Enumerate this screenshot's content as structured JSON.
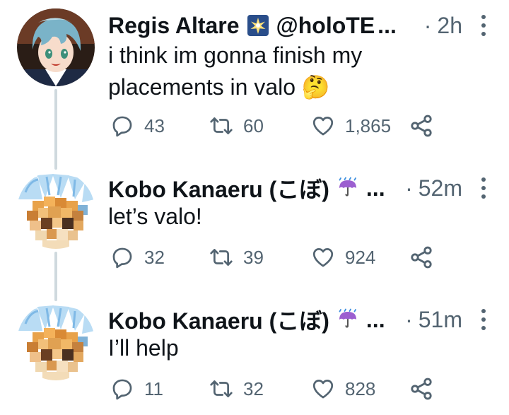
{
  "tweets": [
    {
      "author": {
        "name": "Regis Altare",
        "handle": "@holoTE",
        "truncation": "...",
        "badge_icon": "sparkle-badge-icon"
      },
      "dot": "·",
      "time": "2h",
      "text": "i think im gonna finish my\nplacements in valo",
      "emoji": "🤔",
      "stats": {
        "replies": "43",
        "retweets": "60",
        "likes": "1,865"
      }
    },
    {
      "author": {
        "name": "Kobo Kanaeru (こぼ)",
        "handle": "",
        "truncation": "...",
        "badge_icon": "umbrella-rain-icon"
      },
      "dot": "·",
      "time": "52m",
      "text": "let’s valo!",
      "stats": {
        "replies": "32",
        "retweets": "39",
        "likes": "924"
      }
    },
    {
      "author": {
        "name": "Kobo Kanaeru (こぼ)",
        "handle": "",
        "truncation": "...",
        "badge_icon": "umbrella-rain-icon"
      },
      "dot": "·",
      "time": "51m",
      "text": "I’ll help",
      "stats": {
        "replies": "11",
        "retweets": "32",
        "likes": "828"
      }
    }
  ],
  "colors": {
    "text": "#0f1419",
    "secondary": "#536471",
    "thread_line": "#cfd9de",
    "background": "#ffffff"
  }
}
